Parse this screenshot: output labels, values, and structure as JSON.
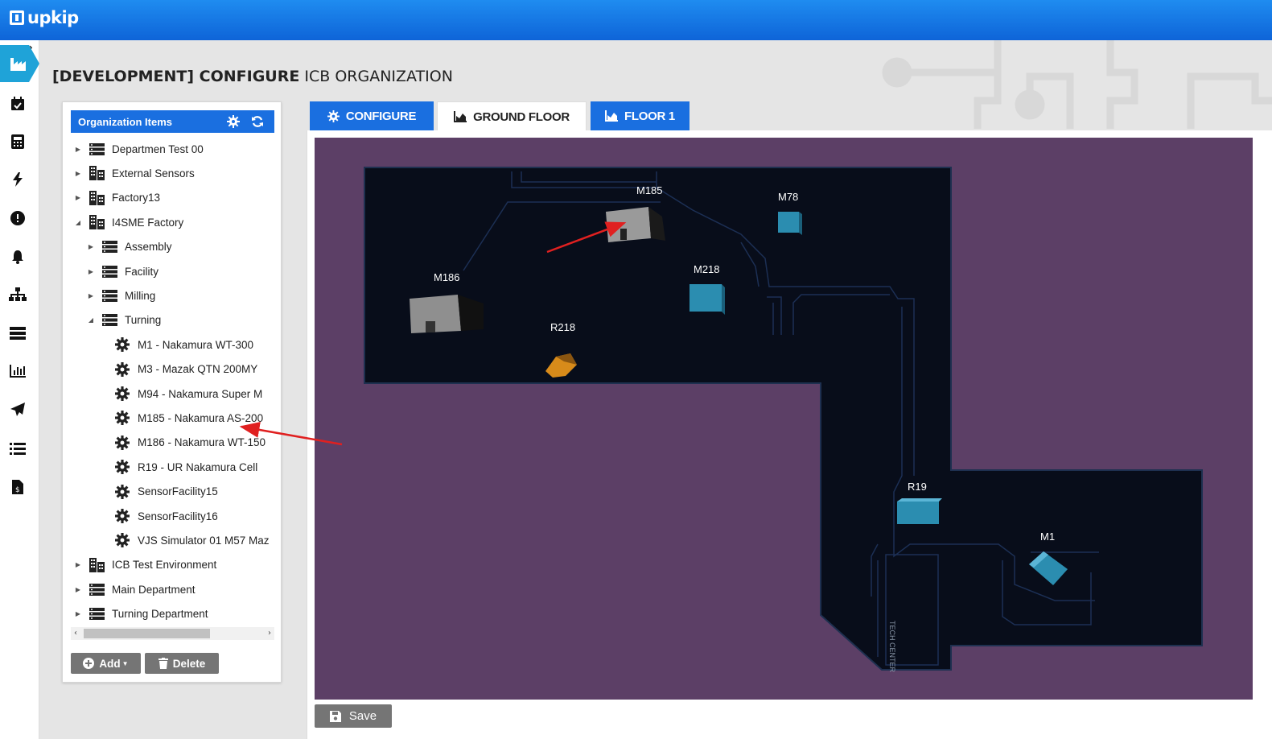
{
  "app": {
    "logo_text": "upkip"
  },
  "page": {
    "title_bold": "[DEVELOPMENT] CONFIGURE",
    "title_rest": " ICB ORGANIZATION"
  },
  "sidebar": {
    "expand_icon": "double-chevron-right-icon",
    "items": [
      {
        "icon": "factory-icon",
        "active": true
      },
      {
        "icon": "calendar-check-icon"
      },
      {
        "icon": "calculator-icon"
      },
      {
        "icon": "bolt-icon"
      },
      {
        "icon": "exclamation-circle-icon"
      },
      {
        "icon": "bell-icon"
      },
      {
        "icon": "sitemap-icon"
      },
      {
        "icon": "server-icon"
      },
      {
        "icon": "bar-chart-icon"
      },
      {
        "icon": "paper-plane-icon"
      },
      {
        "icon": "list-icon"
      },
      {
        "icon": "invoice-dollar-icon"
      }
    ]
  },
  "org_panel": {
    "header": "Organization Items",
    "tree": [
      {
        "label": "Departmen Test 00",
        "level": 0,
        "caret": "collapsed",
        "icon": "server-icon"
      },
      {
        "label": "External Sensors",
        "level": 0,
        "caret": "collapsed",
        "icon": "building-icon"
      },
      {
        "label": "Factory13",
        "level": 0,
        "caret": "collapsed",
        "icon": "building-icon"
      },
      {
        "label": "I4SME Factory",
        "level": 0,
        "caret": "expanded",
        "icon": "building-icon"
      },
      {
        "label": "Assembly",
        "level": 1,
        "caret": "collapsed",
        "icon": "server-icon"
      },
      {
        "label": "Facility",
        "level": 1,
        "caret": "collapsed",
        "icon": "server-icon"
      },
      {
        "label": "Milling",
        "level": 1,
        "caret": "collapsed",
        "icon": "server-icon"
      },
      {
        "label": "Turning",
        "level": 1,
        "caret": "expanded",
        "icon": "server-icon"
      },
      {
        "label": "M1 - Nakamura WT-300",
        "level": 2,
        "caret": "none",
        "icon": "gear-icon"
      },
      {
        "label": "M3 - Mazak QTN 200MY",
        "level": 2,
        "caret": "none",
        "icon": "gear-icon"
      },
      {
        "label": "M94 - Nakamura Super M",
        "level": 2,
        "caret": "none",
        "icon": "gear-icon"
      },
      {
        "label": "M185 - Nakamura AS-200",
        "level": 2,
        "caret": "none",
        "icon": "gear-icon"
      },
      {
        "label": "M186 - Nakamura WT-150",
        "level": 2,
        "caret": "none",
        "icon": "gear-icon"
      },
      {
        "label": "R19 - UR Nakamura Cell",
        "level": 2,
        "caret": "none",
        "icon": "gear-icon"
      },
      {
        "label": "SensorFacility15",
        "level": 2,
        "caret": "none",
        "icon": "gear-icon"
      },
      {
        "label": "SensorFacility16",
        "level": 2,
        "caret": "none",
        "icon": "gear-icon"
      },
      {
        "label": "VJS Simulator 01 M57 Maz",
        "level": 2,
        "caret": "none",
        "icon": "gear-icon"
      },
      {
        "label": "ICB Test Environment",
        "level": 0,
        "caret": "collapsed",
        "icon": "building-icon"
      },
      {
        "label": "Main Department",
        "level": 0,
        "caret": "collapsed",
        "icon": "server-icon"
      },
      {
        "label": "Turning Department",
        "level": 0,
        "caret": "collapsed",
        "icon": "server-icon"
      }
    ],
    "add_label": "Add",
    "delete_label": "Delete"
  },
  "tabs": [
    {
      "label": "CONFIGURE",
      "icon": "gear-icon",
      "active": false
    },
    {
      "label": "GROUND FLOOR",
      "icon": "area-chart-icon",
      "active": true
    },
    {
      "label": "FLOOR 1",
      "icon": "area-chart-icon",
      "active": false
    }
  ],
  "floor_plan": {
    "machines": [
      "M185",
      "M78",
      "M218",
      "M186",
      "R218",
      "R19",
      "M1"
    ],
    "room_label": "TECH CENTER"
  },
  "save_label": "Save",
  "colors": {
    "primary": "#1a6fe0",
    "floor_bg": "#5c3f66",
    "plan_bg": "#080d1a",
    "annotation": "#e02020"
  }
}
